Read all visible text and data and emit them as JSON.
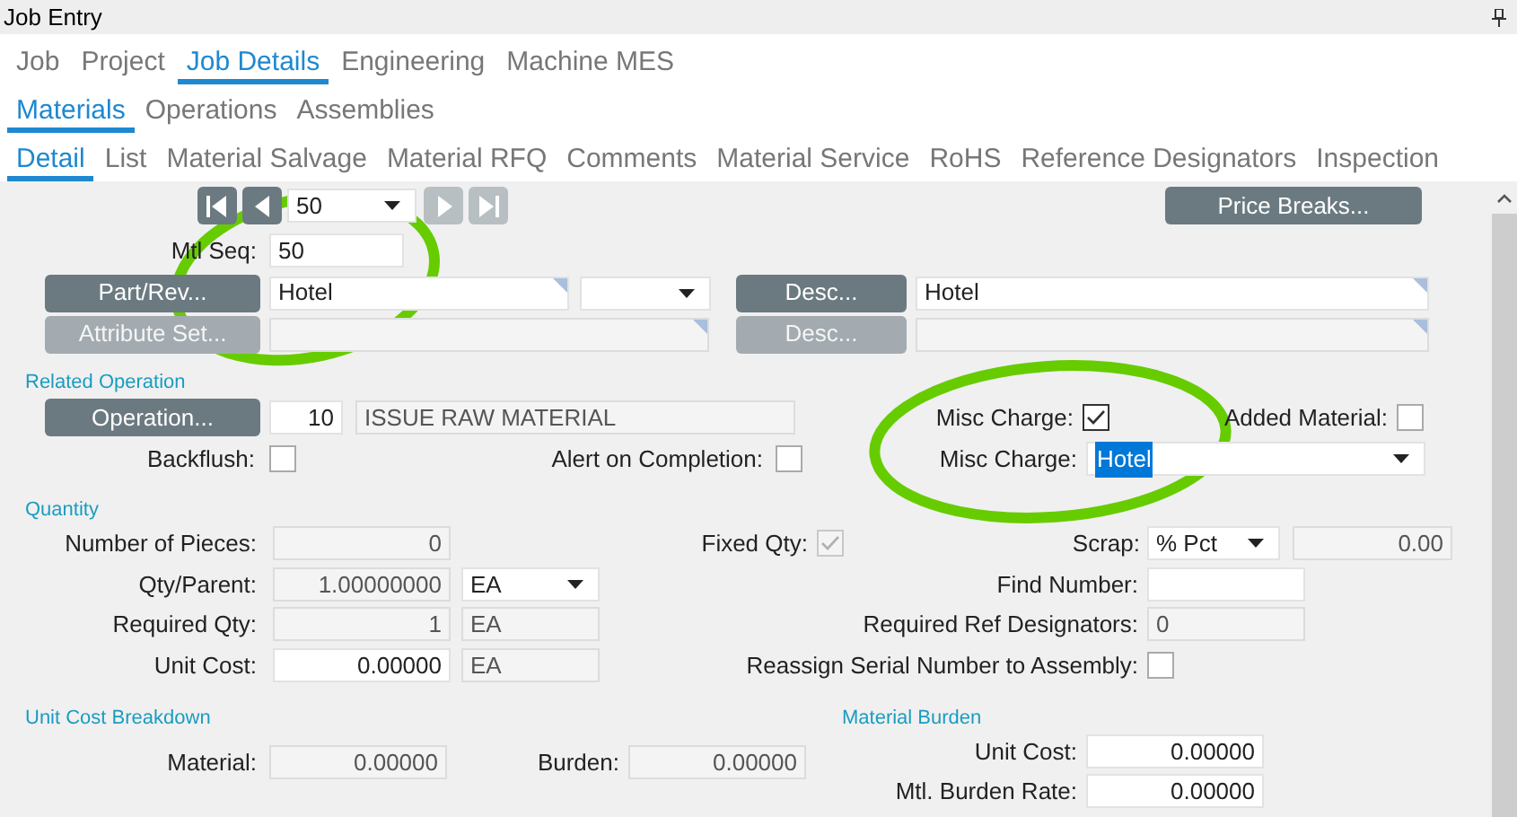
{
  "window": {
    "title": "Job Entry"
  },
  "tabs": [
    {
      "label": "Job",
      "selected": false
    },
    {
      "label": "Project",
      "selected": false
    },
    {
      "label": "Job Details",
      "selected": true
    },
    {
      "label": "Engineering",
      "selected": false
    },
    {
      "label": "Machine MES",
      "selected": false
    }
  ],
  "subtabs": [
    {
      "label": "Materials",
      "selected": true
    },
    {
      "label": "Operations",
      "selected": false
    },
    {
      "label": "Assemblies",
      "selected": false
    }
  ],
  "detail_tabs": [
    {
      "label": "Detail",
      "selected": true
    },
    {
      "label": "List",
      "selected": false
    },
    {
      "label": "Material Salvage",
      "selected": false
    },
    {
      "label": "Material RFQ",
      "selected": false
    },
    {
      "label": "Comments",
      "selected": false
    },
    {
      "label": "Material Service",
      "selected": false
    },
    {
      "label": "RoHS",
      "selected": false
    },
    {
      "label": "Reference Designators",
      "selected": false
    },
    {
      "label": "Inspection",
      "selected": false
    }
  ],
  "navigator": {
    "value": "50",
    "first_disabled": false,
    "prev_disabled": false,
    "next_disabled": true,
    "last_disabled": true
  },
  "price_breaks_button": {
    "label": "Price Breaks...",
    "disabled": false
  },
  "mtl_seq": {
    "label": "Mtl Seq:",
    "value": "50"
  },
  "part_row": {
    "button": "Part/Rev...",
    "value": "Hotel",
    "desc_button": "Desc...",
    "desc_value": "Hotel",
    "disabled": false
  },
  "attribute_row": {
    "button": "Attribute Set...",
    "desc_button": "Desc...",
    "disabled": true
  },
  "related_operation": {
    "heading": "Related Operation",
    "button": "Operation...",
    "number": "10",
    "description": "ISSUE RAW MATERIAL",
    "backflush": {
      "label": "Backflush:",
      "checked": false
    },
    "alert_on_completion": {
      "label": "Alert on Completion:",
      "checked": false
    }
  },
  "misc_charge_check": {
    "label": "Misc Charge:",
    "checked": true
  },
  "added_material": {
    "label": "Added Material:",
    "checked": false
  },
  "misc_charge_combo": {
    "label": "Misc Charge:",
    "value": "Hotel",
    "text_selected": true
  },
  "quantity": {
    "heading": "Quantity",
    "number_of_pieces": {
      "label": "Number of Pieces:",
      "value": "0",
      "disabled": true
    },
    "fixed_qty": {
      "label": "Fixed Qty:",
      "checked": true,
      "disabled": true
    },
    "scrap": {
      "label": "Scrap:",
      "type": "% Pct",
      "value": "0.00"
    },
    "qty_parent": {
      "label": "Qty/Parent:",
      "value": "1.00000000",
      "uom": "EA",
      "disabled": true
    },
    "find_number": {
      "label": "Find Number:"
    },
    "required_qty": {
      "label": "Required Qty:",
      "value": "1",
      "uom": "EA",
      "disabled": true
    },
    "required_ref_designators": {
      "label": "Required Ref Designators:",
      "value": "0",
      "disabled": true
    },
    "unit_cost": {
      "label": "Unit Cost:",
      "value": "0.00000",
      "uom": "EA",
      "disabled": false
    },
    "reassign_serial": {
      "label": "Reassign Serial Number to Assembly:",
      "checked": false
    }
  },
  "unit_cost_breakdown": {
    "heading": "Unit Cost Breakdown",
    "material": {
      "label": "Material:",
      "value": "0.00000",
      "disabled": true
    },
    "burden": {
      "label": "Burden:",
      "value": "0.00000",
      "disabled": true
    }
  },
  "material_burden": {
    "heading": "Material Burden",
    "unit_cost": {
      "label": "Unit Cost:",
      "value": "0.00000",
      "disabled": false
    },
    "mtl_burden_rate": {
      "label": "Mtl. Burden Rate:",
      "value": "0.00000",
      "disabled": false
    }
  }
}
